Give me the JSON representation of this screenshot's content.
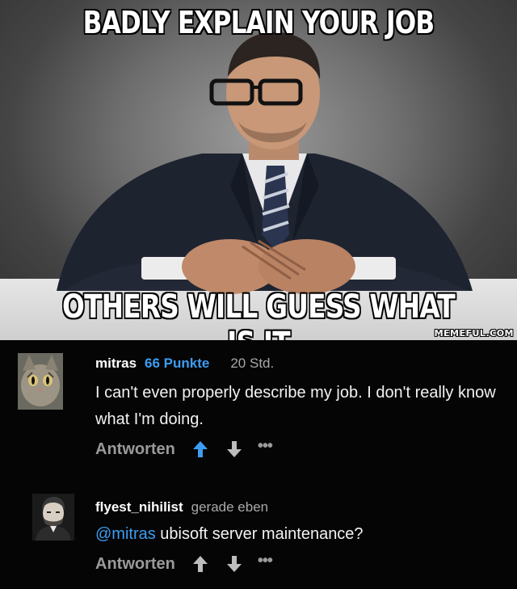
{
  "meme": {
    "top_caption": "BADLY EXPLAIN YOUR JOB",
    "bottom_caption": "OTHERS WILL GUESS WHAT IS IT",
    "watermark": "MEMEFUL.COM"
  },
  "comments": [
    {
      "username": "mitras",
      "points": "66 Punkte",
      "time": "20 Std.",
      "text": "I can't even properly describe my job. I don't really know what I'm doing.",
      "reply_label": "Antworten",
      "upvote_color": "#3d9df3",
      "downvote_color": "#bdbdbd",
      "more_label": "•••",
      "avatar_icon": "cat-avatar"
    },
    {
      "username": "flyest_nihilist",
      "time": "gerade eben",
      "mention": "@mitras",
      "text": " ubisoft server maintenance?",
      "reply_label": "Antworten",
      "upvote_color": "#bdbdbd",
      "downvote_color": "#bdbdbd",
      "more_label": "•••",
      "avatar_icon": "portrait-avatar"
    }
  ]
}
